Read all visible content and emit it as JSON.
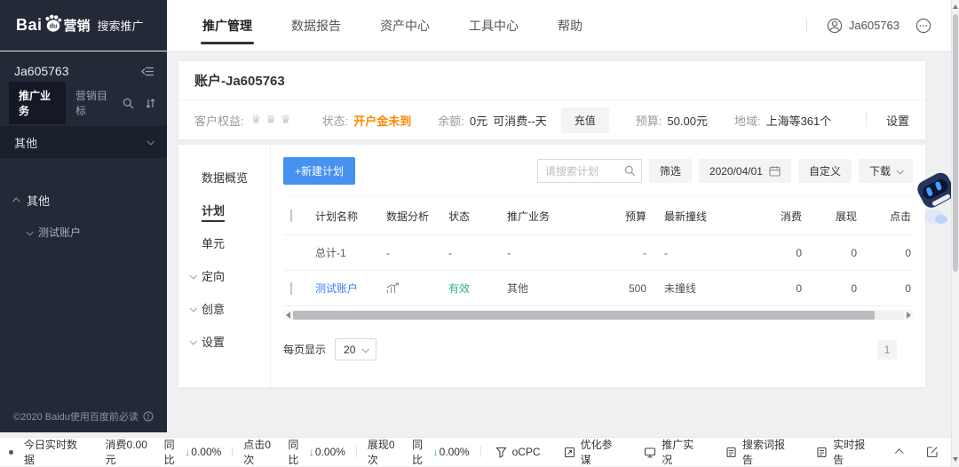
{
  "brand": {
    "logo_left": "Bai",
    "logo_paw": "du",
    "logo_right": "营销",
    "product": "搜索推广"
  },
  "top_nav": {
    "items": [
      {
        "label": "推广管理"
      },
      {
        "label": "数据报告"
      },
      {
        "label": "资产中心"
      },
      {
        "label": "工具中心"
      },
      {
        "label": "帮助"
      }
    ],
    "username": "Ja605763"
  },
  "sidebar": {
    "account": "Ja605763",
    "tab_business": "推广业务",
    "tab_goal": "营销目标",
    "filter_label": "其他",
    "group_label": "其他",
    "child_label": "测试账户",
    "footer": "©2020 Baidu使用百度前必读"
  },
  "account_bar": {
    "title": "账户-Ja605763",
    "rights_label": "客户权益:",
    "rights_stars": "♛♛♛",
    "status_label": "状态:",
    "status_value": "开户金未到",
    "balance_label": "余额:",
    "balance_value": "0元",
    "balance_days": "可消费--天",
    "recharge": "充值",
    "budget_label": "预算:",
    "budget_value": "50.00元",
    "region_label": "地域:",
    "region_value": "上海等361个",
    "settings": "设置"
  },
  "subnav": {
    "overview": "数据概览",
    "plan": "计划",
    "unit": "单元",
    "targeting": "定向",
    "creative": "创意",
    "settings": "设置"
  },
  "toolbar": {
    "new_plan": "+新建计划",
    "search_placeholder": "请搜索计划",
    "filter": "筛选",
    "date": "2020/04/01",
    "custom": "自定义",
    "download": "下载"
  },
  "table": {
    "headers": [
      "计划名称",
      "数据分析",
      "状态",
      "推广业务",
      "预算",
      "最新撞线",
      "消费",
      "展现",
      "点击"
    ],
    "rows": [
      {
        "name": "总计-1",
        "analysis": "-",
        "status": "-",
        "biz": "-",
        "budget": "-",
        "line": "-",
        "cost": "0",
        "show": "0",
        "click": "0"
      },
      {
        "name": "测试账户",
        "status": "有效",
        "biz": "其他",
        "budget": "500",
        "line": "未撞线",
        "cost": "0",
        "show": "0",
        "click": "0"
      }
    ]
  },
  "pagination": {
    "label": "每页显示",
    "per_page": "20",
    "page": "1"
  },
  "status_bar": {
    "today": "今日实时数据",
    "metrics": [
      {
        "value": "消费0.00元",
        "cmp": "同比",
        "arrow": "↓",
        "pct": "0.00%"
      },
      {
        "value": "点击0次",
        "cmp": "同比",
        "arrow": "↓",
        "pct": "0.00%"
      },
      {
        "value": "展现0次",
        "cmp": "同比",
        "arrow": "↓",
        "pct": "0.00%"
      }
    ],
    "links": [
      "oCPC",
      "优化参谋",
      "推广实况",
      "搜索词报告",
      "实时报告"
    ]
  },
  "colors": {
    "accent_blue": "#4791F1",
    "link_blue": "#3E7FF5",
    "success_green": "#2BB57A",
    "warn_orange": "#FF8800",
    "sidebar_bg": "#232936"
  }
}
